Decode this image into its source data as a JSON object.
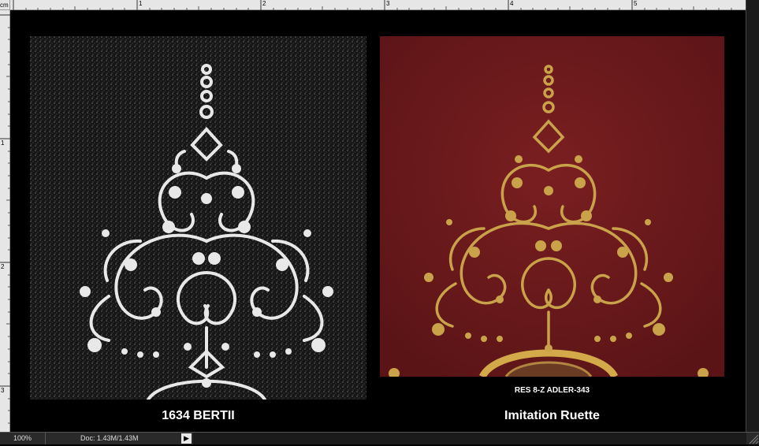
{
  "ruler": {
    "unit": "cm",
    "top_numbers": [
      "1",
      "2",
      "3",
      "4",
      "5"
    ],
    "left_numbers": [
      "1",
      "2",
      "3"
    ]
  },
  "images": {
    "left": {
      "caption": "1634 BERTII",
      "tone": "black-and-white halftone scan"
    },
    "right": {
      "caption": "Imitation Ruette",
      "reference": "RES 8-Z ADLER-343",
      "tone": "gold tooling on red leather"
    }
  },
  "status": {
    "zoom": "100%",
    "doc": "Doc: 1.43M/1.43M",
    "arrow": "▶"
  },
  "colors": {
    "background": "#000000",
    "leather": "#6e1a1c",
    "gold": "#c9a24a",
    "ornament_white": "#e8e8e8"
  },
  "icons": [
    "play-arrow-icon",
    "resize-grip-icon"
  ]
}
